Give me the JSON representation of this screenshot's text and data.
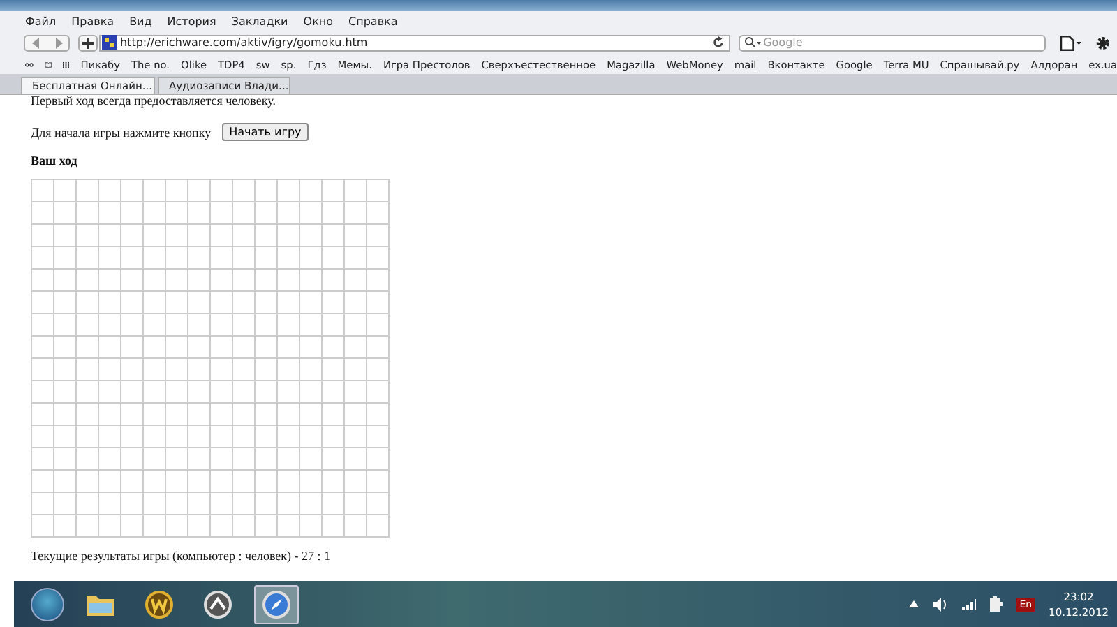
{
  "menu": [
    "Файл",
    "Правка",
    "Вид",
    "История",
    "Закладки",
    "Окно",
    "Справка"
  ],
  "address": {
    "url": "http://erichware.com/aktiv/igry/gomoku.htm"
  },
  "search": {
    "placeholder": "Google"
  },
  "bookmarks": [
    "Пикабу",
    "The no.",
    "Olike",
    "TDP4",
    "sw",
    "sp.",
    "Гдз",
    "Мемы.",
    "Игра Престолов",
    "Сверхъестественное",
    "Magazilla",
    "WebMoney",
    "mail",
    "Вконтакте",
    "Google",
    "Terra MU",
    "Спрашывай.ру",
    "Алдоран",
    "ex.ua"
  ],
  "tabs": [
    {
      "label": "Бесплатная Онлайн...",
      "selected": true
    },
    {
      "label": "Аудиозаписи Влади...",
      "selected": false
    }
  ],
  "page": {
    "intro": "Первый ход всегда предоставляется человеку.",
    "start_prompt": "Для начала игры нажмите кнопку",
    "start_button": "Начать игру",
    "turn": "Ваш ход",
    "score": "Текущие результаты игры (компьютер : человек) -  27 : 1"
  },
  "taskbar": {
    "apps": [
      {
        "kind": "folder",
        "selected": false
      },
      {
        "kind": "game",
        "selected": false
      },
      {
        "kind": "arrow",
        "selected": false
      },
      {
        "kind": "compass",
        "selected": true
      }
    ],
    "language": "En",
    "time": "23:02",
    "date": "10.12.2012"
  }
}
